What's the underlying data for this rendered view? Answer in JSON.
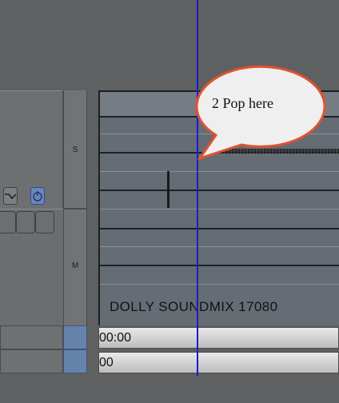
{
  "side_labels": {
    "solo": "S",
    "mute": "M"
  },
  "track": {
    "clip_name": "DOLLY SOUNDMIX 17080"
  },
  "timecodes": {
    "row1": "00:00",
    "row2": "00"
  },
  "annotation": {
    "text": "2 Pop here"
  },
  "colors": {
    "playhead": "#1b1bd6",
    "bubble_fill": "#efefef",
    "bubble_border": "#e2522e",
    "active_button": "#6b87b8"
  },
  "icons": [
    "graph-icon",
    "power-icon"
  ]
}
